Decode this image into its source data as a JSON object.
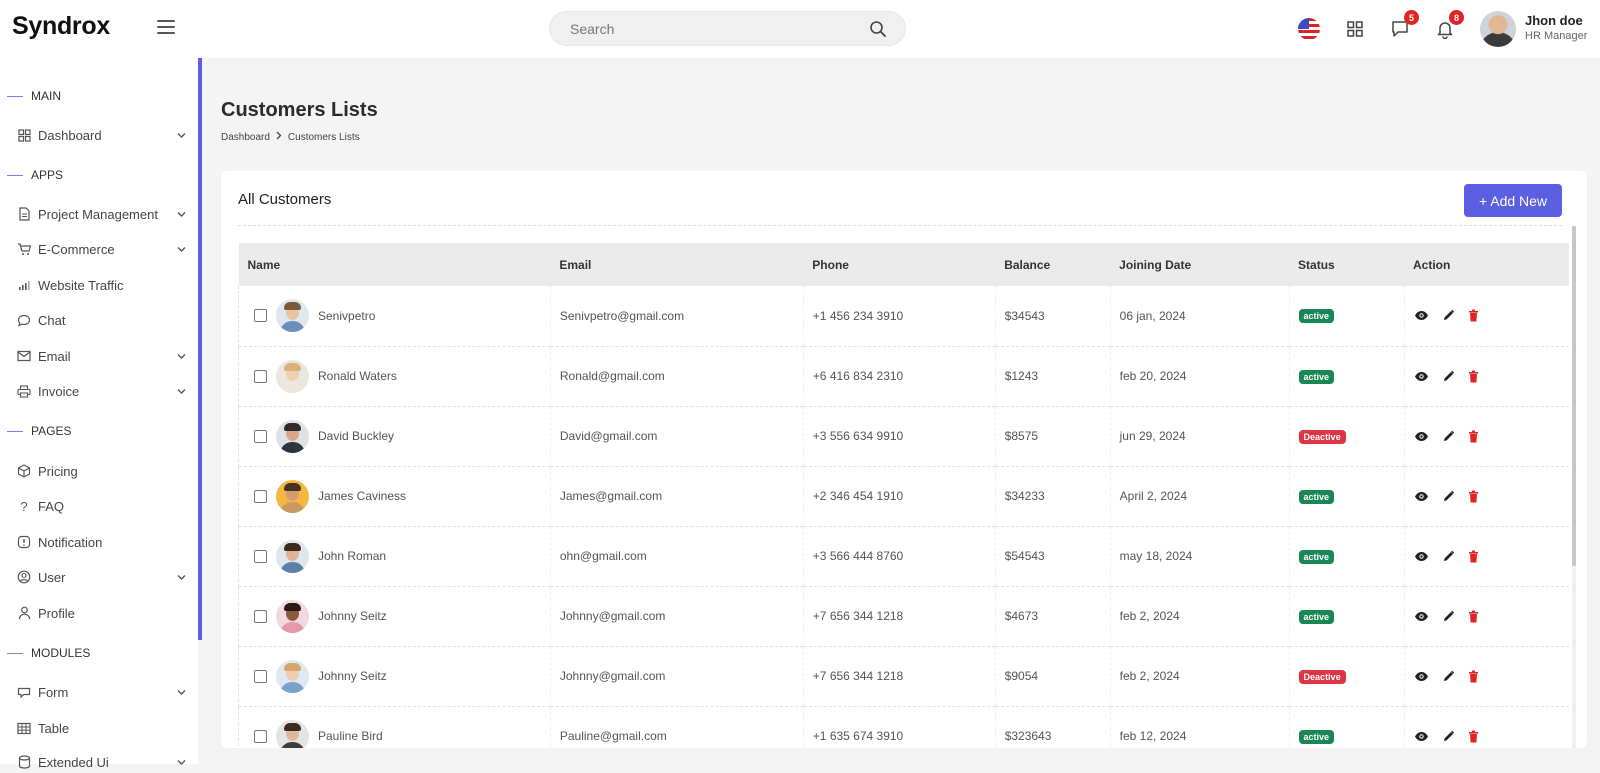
{
  "app": {
    "brand": "Syndrox"
  },
  "header": {
    "search_placeholder": "Search",
    "messages_badge": "5",
    "notifications_badge": "8",
    "user_name": "Jhon doe",
    "user_role": "HR Manager"
  },
  "sidebar": {
    "sections": [
      "MAIN",
      "APPS",
      "PAGES",
      "MODULES"
    ],
    "items": [
      {
        "label": "Dashboard",
        "icon": "grid-icon",
        "chevron": true
      },
      {
        "label": "Project Management",
        "icon": "document-icon",
        "chevron": true
      },
      {
        "label": "E-Commerce",
        "icon": "cart-icon",
        "chevron": true
      },
      {
        "label": "Website Traffic",
        "icon": "bar-chart-icon",
        "chevron": false
      },
      {
        "label": "Chat",
        "icon": "chat-icon",
        "chevron": false
      },
      {
        "label": "Email",
        "icon": "mail-icon",
        "chevron": true
      },
      {
        "label": "Invoice",
        "icon": "printer-icon",
        "chevron": true
      },
      {
        "label": "Pricing",
        "icon": "box-icon",
        "chevron": false
      },
      {
        "label": "FAQ",
        "icon": "question-icon",
        "chevron": false
      },
      {
        "label": "Notification",
        "icon": "alert-icon",
        "chevron": false
      },
      {
        "label": "User",
        "icon": "user-circle-icon",
        "chevron": true
      },
      {
        "label": "Profile",
        "icon": "person-icon",
        "chevron": false
      },
      {
        "label": "Form",
        "icon": "form-icon",
        "chevron": true
      },
      {
        "label": "Table",
        "icon": "table-icon",
        "chevron": false
      },
      {
        "label": "Extended Ui",
        "icon": "database-icon",
        "chevron": true
      }
    ]
  },
  "page": {
    "title": "Customers Lists",
    "breadcrumb": [
      "Dashboard",
      "Customers Lists"
    ]
  },
  "card": {
    "title": "All Customers",
    "add_button": "+ Add New"
  },
  "table": {
    "columns": [
      "Name",
      "Email",
      "Phone",
      "Balance",
      "Joining Date",
      "Status",
      "Action"
    ],
    "rows": [
      {
        "name": "Senivpetro",
        "email": "Senivpetro@gmail.com",
        "phone": "+1 456 234 3910",
        "balance": "$34543",
        "date": "06 jan, 2024",
        "status": "active"
      },
      {
        "name": "Ronald Waters",
        "email": "Ronald@gmail.com",
        "phone": "+6 416 834 2310",
        "balance": "$1243",
        "date": "feb 20, 2024",
        "status": "active"
      },
      {
        "name": "David Buckley",
        "email": "David@gmail.com",
        "phone": "+3 556 634 9910",
        "balance": "$8575",
        "date": "jun 29, 2024",
        "status": "Deactive"
      },
      {
        "name": "James Caviness",
        "email": "James@gmail.com",
        "phone": "+2 346 454 1910",
        "balance": "$34233",
        "date": "April 2, 2024",
        "status": "active"
      },
      {
        "name": "John Roman",
        "email": "ohn@gmail.com",
        "phone": "+3 566 444 8760",
        "balance": "$54543",
        "date": "may 18, 2024",
        "status": "active"
      },
      {
        "name": "Johnny Seitz",
        "email": "Johnny@gmail.com",
        "phone": "+7 656 344 1218",
        "balance": "$4673",
        "date": "feb 2, 2024",
        "status": "active"
      },
      {
        "name": "Johnny Seitz",
        "email": "Johnny@gmail.com",
        "phone": "+7 656 344 1218",
        "balance": "$9054",
        "date": "feb 2, 2024",
        "status": "Deactive"
      },
      {
        "name": "Pauline Bird",
        "email": "Pauline@gmail.com",
        "phone": "+1 635 674 3910",
        "balance": "$323643",
        "date": "feb 12, 2024",
        "status": "active"
      }
    ]
  },
  "colors": {
    "accent": "#5b5fe0",
    "active": "#198754",
    "deactive": "#dc3545",
    "delete": "#e02424"
  }
}
